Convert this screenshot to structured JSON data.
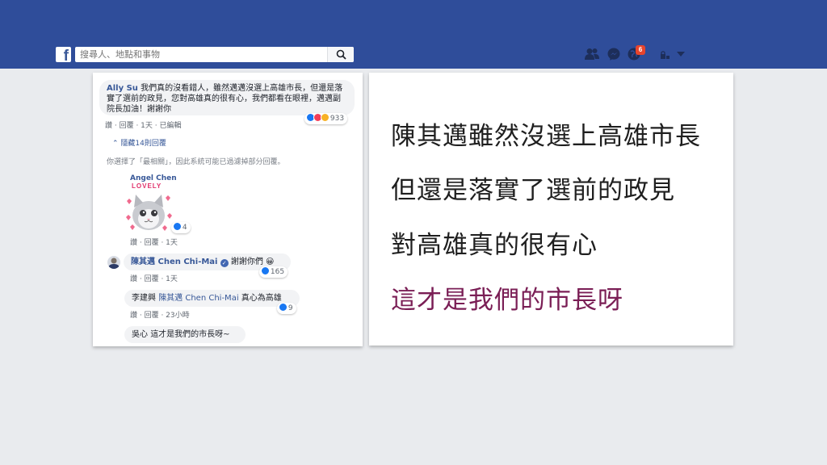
{
  "header": {
    "logo_letter": "f",
    "search_placeholder": "搜尋人、地點和事物",
    "notification_count": "6"
  },
  "comments": {
    "main": {
      "author": "Ally Su",
      "text": "我們真的沒看錯人，雖然邁邁沒選上高雄市長，但還是落實了選前的政見，您對高雄真的很有心，我們都看在眼裡，邁邁副院長加油！謝謝你",
      "meta": "讚 · 回覆 · 1天 · 已編輯",
      "reaction_count": "933"
    },
    "hidden_replies": "隱藏14則回覆",
    "filter_notice": "你選擇了「最相關」，因此系統可能已過濾掉部分回覆。",
    "reply1": {
      "author": "Angel Chen",
      "sticker_text": "LOVELY",
      "reaction_count": "4",
      "meta": "讚 · 回覆 · 1天"
    },
    "reply2": {
      "author": "陳其邁 Chen Chi-Mai",
      "text": "謝謝你們 😀",
      "reaction_count": "165",
      "meta": "讚 · 回覆 · 1天"
    },
    "reply3": {
      "author": "李建興",
      "mention": "陳其邁 Chen Chi-Mai",
      "text": "真心為高雄",
      "reaction_count": "9",
      "meta": "讚 · 回覆 · 23小時"
    },
    "reply4": {
      "author": "吳心",
      "text": "這才是我們的市長呀~"
    }
  },
  "caption": {
    "line1": "陳其邁雖然沒選上高雄市長",
    "line2": "但還是落實了選前的政見",
    "line3": "對高雄真的很有心",
    "line4": "這才是我們的市長呀",
    "highlight_color": "#7a1e55"
  },
  "colors": {
    "topbar": "#2f4d9a",
    "link": "#385898",
    "like_blue": "#1877f2",
    "love_red": "#f33e58",
    "haha_yellow": "#f7b125"
  }
}
